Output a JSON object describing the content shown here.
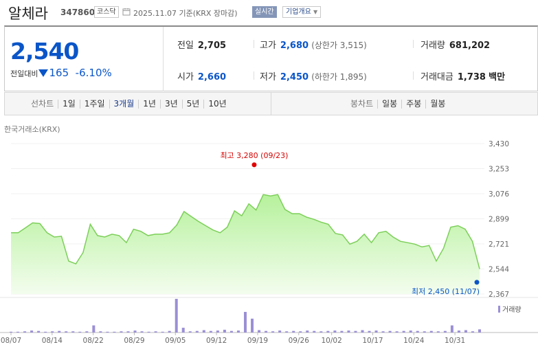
{
  "header": {
    "stock_name": "알체라",
    "stock_code": "347860",
    "market_badge": "코스닥",
    "date_text": "2025.11.07 기준(KRX 장마감)",
    "realtime_button": "실시간",
    "company_overview_button": "기업개요"
  },
  "quote": {
    "price": "2,540",
    "change_label": "전일대비",
    "change_value": "165",
    "change_pct": "-6.10%",
    "prev_close_label": "전일",
    "prev_close": "2,705",
    "high_label": "고가",
    "high": "2,680",
    "upper_limit": "(상한가 3,515)",
    "volume_label": "거래량",
    "volume": "681,202",
    "open_label": "시가",
    "open": "2,660",
    "low_label": "저가",
    "low": "2,450",
    "lower_limit": "(하한가 1,895)",
    "value_label": "거래대금",
    "value": "1,738",
    "value_unit": "백만"
  },
  "tabs": {
    "line_chart": "선차트",
    "periods": [
      "1일",
      "1주일",
      "3개월",
      "1년",
      "3년",
      "5년",
      "10년"
    ],
    "active_period": "3개월",
    "candle_chart": "봉차트",
    "candle_periods": [
      "일봉",
      "주봉",
      "월봉"
    ]
  },
  "exchange_label": "한국거래소(KRX)",
  "colors": {
    "down": "#0a55c8",
    "up": "#d60000",
    "volume": "#9b8fd6",
    "area": "#c8f5b4",
    "line": "#7ccf59"
  },
  "chart_data": {
    "type": "area",
    "y_ticks": [
      "3,430",
      "3,253",
      "3,076",
      "2,899",
      "2,721",
      "2,544",
      "2,367"
    ],
    "ylim": [
      2367,
      3430
    ],
    "x_ticks": [
      "08/07",
      "08/14",
      "08/22",
      "08/29",
      "09/05",
      "09/12",
      "09/19",
      "09/26",
      "10/02",
      "10/17",
      "10/24",
      "10/31"
    ],
    "x_tick_index": [
      0,
      5,
      10,
      15,
      20,
      25,
      30,
      35,
      39,
      44,
      49,
      54
    ],
    "n_days": 58,
    "prices": [
      2800,
      2800,
      2835,
      2870,
      2865,
      2800,
      2770,
      2775,
      2600,
      2580,
      2660,
      2860,
      2780,
      2770,
      2790,
      2780,
      2730,
      2825,
      2810,
      2780,
      2790,
      2790,
      2800,
      2855,
      2950,
      2915,
      2880,
      2850,
      2820,
      2800,
      2840,
      2955,
      2920,
      3005,
      2960,
      3070,
      3060,
      3070,
      2965,
      2935,
      2935,
      2910,
      2895,
      2875,
      2860,
      2795,
      2785,
      2720,
      2740,
      2790,
      2730,
      2800,
      2810,
      2770,
      2740,
      2730,
      2720,
      2700,
      2710,
      2600,
      2690,
      2840,
      2850,
      2825,
      2740,
      2544
    ],
    "volume_rel": [
      2,
      2,
      3,
      5,
      4,
      2,
      3,
      4,
      3,
      3,
      2,
      3,
      18,
      3,
      2,
      2,
      3,
      3,
      5,
      3,
      2,
      3,
      2,
      4,
      85,
      12,
      3,
      4,
      6,
      4,
      5,
      7,
      4,
      5,
      52,
      35,
      6,
      4,
      3,
      5,
      3,
      4,
      3,
      5,
      4,
      3,
      4,
      5,
      4,
      5,
      4,
      6,
      4,
      5,
      3,
      4,
      3,
      4,
      5,
      4,
      3,
      4,
      3,
      4,
      18,
      5,
      6,
      3,
      8
    ],
    "high_label": "최고  3,280 (09/23)",
    "high_value": 3280,
    "high_index_frac": 0.519,
    "low_label": "최저  2,450 (11/07)",
    "low_value": 2450,
    "volume_legend": "거래량"
  }
}
